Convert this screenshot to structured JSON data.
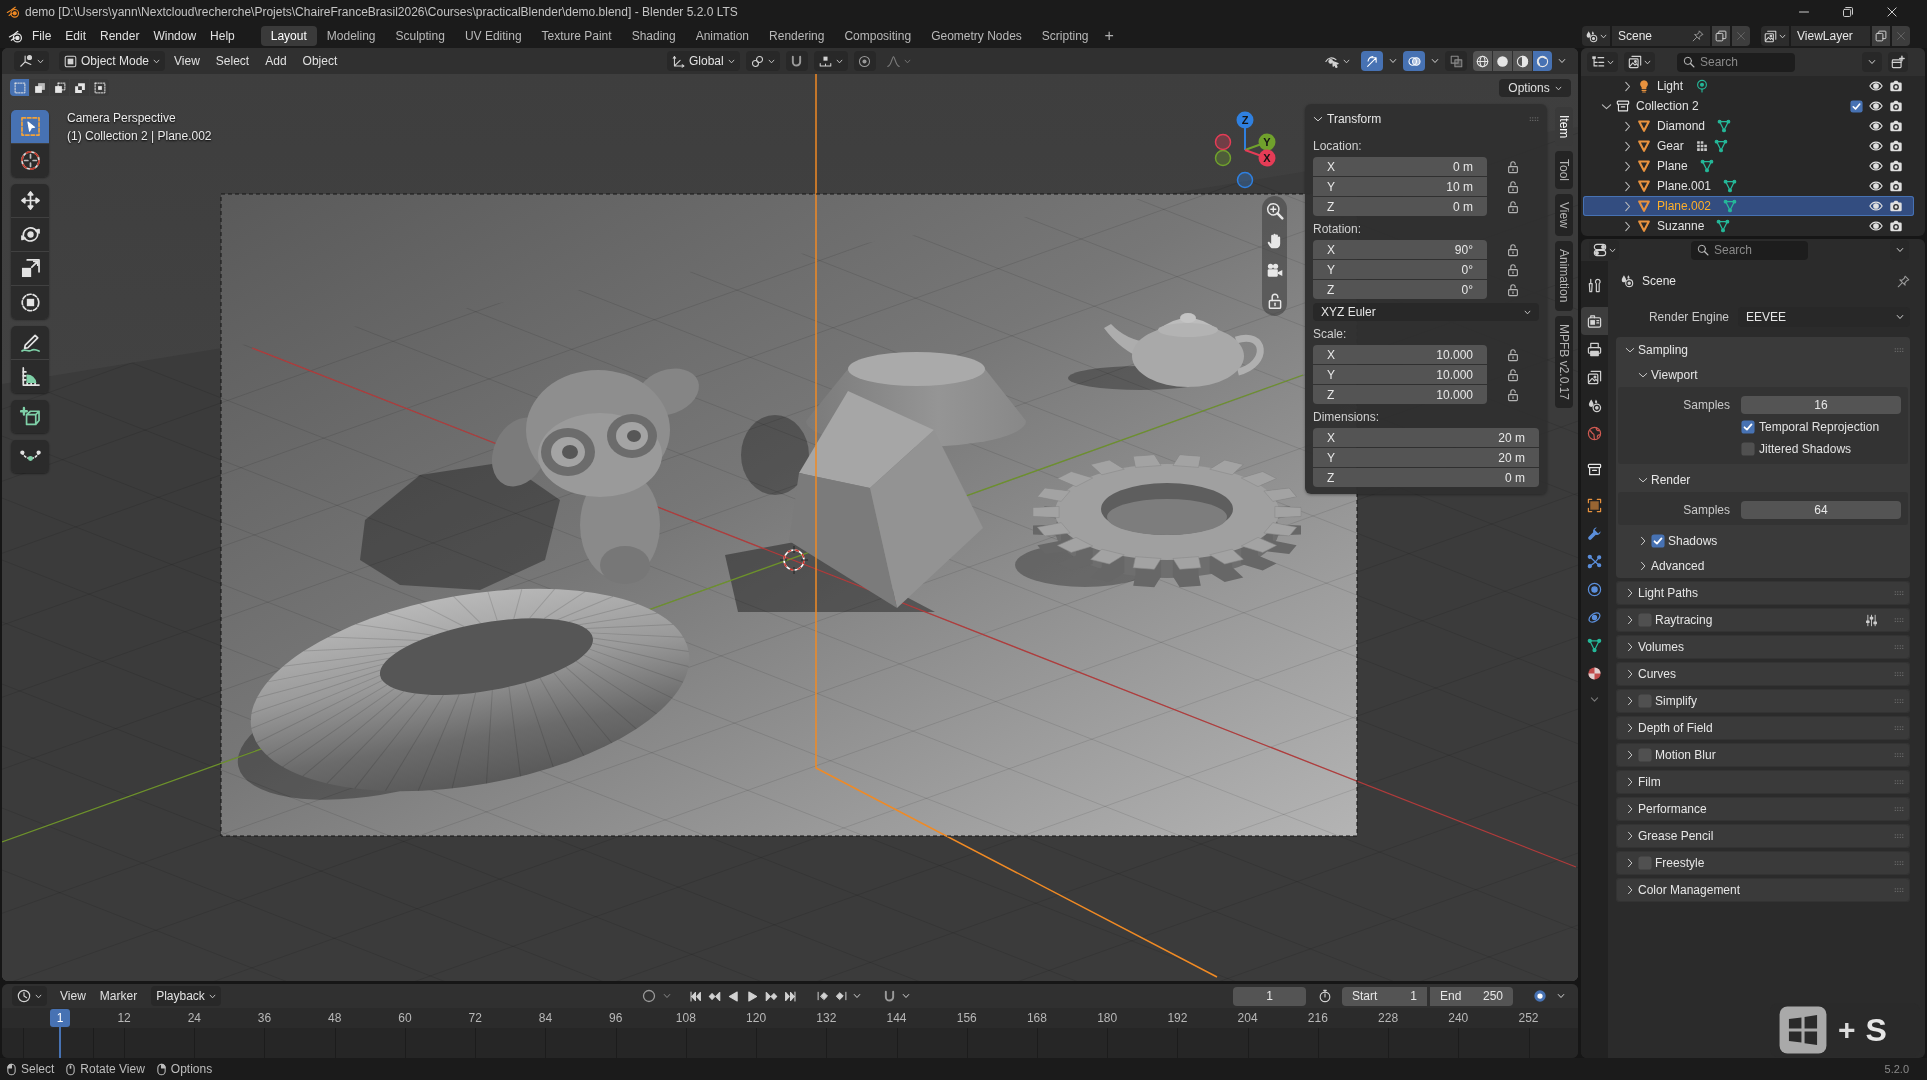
{
  "window": {
    "title": "demo [D:\\Users\\yann\\Nextcloud\\recherche\\Projets\\ChaireFranceBrasil2026\\Courses\\practicalBlender\\demo.blend] - Blender 5.2.0 LTS"
  },
  "menu": [
    "File",
    "Edit",
    "Render",
    "Window",
    "Help"
  ],
  "workspaces": [
    {
      "label": "Layout",
      "selected": true
    },
    {
      "label": "Modeling",
      "selected": false
    },
    {
      "label": "Sculpting",
      "selected": false
    },
    {
      "label": "UV Editing",
      "selected": false
    },
    {
      "label": "Texture Paint",
      "selected": false
    },
    {
      "label": "Shading",
      "selected": false
    },
    {
      "label": "Animation",
      "selected": false
    },
    {
      "label": "Rendering",
      "selected": false
    },
    {
      "label": "Compositing",
      "selected": false
    },
    {
      "label": "Geometry Nodes",
      "selected": false
    },
    {
      "label": "Scripting",
      "selected": false
    }
  ],
  "add_workspace": "+",
  "scene": {
    "value": "Scene"
  },
  "view_layer": {
    "value": "ViewLayer"
  },
  "viewport": {
    "mode": "Object Mode",
    "menus": [
      "View",
      "Select",
      "Add",
      "Object"
    ],
    "orientation": "Global",
    "snap_toggles": [
      {
        "kind": "snap",
        "on": false
      },
      {
        "kind": "proportional",
        "on": false
      }
    ],
    "overlay_toggles": [
      {
        "kind": "gizmos",
        "on": true
      },
      {
        "kind": "overlays",
        "on": true
      },
      {
        "kind": "xray",
        "on": false
      }
    ],
    "shading": [
      {
        "kind": "wireframe",
        "selected": false
      },
      {
        "kind": "solid",
        "selected": false
      },
      {
        "kind": "material",
        "selected": false
      },
      {
        "kind": "rendered",
        "selected": true
      }
    ],
    "options": "Options",
    "select_modes": [
      {
        "kind": "set",
        "selected": true
      },
      {
        "kind": "extend",
        "selected": false
      },
      {
        "kind": "subtract",
        "selected": false
      },
      {
        "kind": "difference",
        "selected": false
      },
      {
        "kind": "intersect",
        "selected": false
      }
    ],
    "tool_groups": [
      {
        "tools": [
          {
            "kind": "select-box",
            "selected": true
          },
          {
            "kind": "cursor",
            "selected": false
          }
        ]
      },
      {
        "tools": [
          {
            "kind": "move",
            "selected": false
          },
          {
            "kind": "rotate",
            "selected": false
          },
          {
            "kind": "scale",
            "selected": false
          },
          {
            "kind": "transform",
            "selected": false
          }
        ]
      },
      {
        "tools": [
          {
            "kind": "annotate",
            "selected": false
          },
          {
            "kind": "measure",
            "selected": false
          }
        ]
      },
      {
        "tools": [
          {
            "kind": "add-cube",
            "selected": false
          }
        ]
      },
      {
        "tools": [
          {
            "kind": "curve",
            "selected": false
          }
        ]
      }
    ],
    "info": [
      "Camera Perspective",
      "(1) Collection 2 | Plane.002"
    ],
    "gizmo_axes": [
      {
        "label": "Z",
        "color": "#2f80e0"
      },
      {
        "label": "Y",
        "color": "#70a12c"
      },
      {
        "label": "X",
        "color": "#e53c56"
      }
    ],
    "sidebar": {
      "tabs": [
        {
          "label": "Item",
          "selected": true
        },
        {
          "label": "Tool",
          "selected": false
        },
        {
          "label": "View",
          "selected": false
        },
        {
          "label": "Animation",
          "selected": false
        },
        {
          "label": "MPFB v2.0.17",
          "selected": false
        }
      ],
      "transform": {
        "title": "Transform",
        "expanded": true,
        "groups": [
          {
            "label": "Location:",
            "fields": [
              {
                "axis": "X",
                "value": "0 m",
                "locked": false
              },
              {
                "axis": "Y",
                "value": "10 m",
                "locked": false
              },
              {
                "axis": "Z",
                "value": "0 m",
                "locked": false
              }
            ]
          },
          {
            "label": "Rotation:",
            "fields": [
              {
                "axis": "X",
                "value": "90°",
                "locked": false
              },
              {
                "axis": "Y",
                "value": "0°",
                "locked": false
              },
              {
                "axis": "Z",
                "value": "0°",
                "locked": false
              }
            ],
            "mode": "XYZ Euler"
          },
          {
            "label": "Scale:",
            "fields": [
              {
                "axis": "X",
                "value": "10.000",
                "locked": false
              },
              {
                "axis": "Y",
                "value": "10.000",
                "locked": false
              },
              {
                "axis": "Z",
                "value": "10.000",
                "locked": false
              }
            ]
          },
          {
            "label": "Dimensions:",
            "fields": [
              {
                "axis": "X",
                "value": "20 m"
              },
              {
                "axis": "Y",
                "value": "20 m"
              },
              {
                "axis": "Z",
                "value": "0 m"
              }
            ]
          }
        ]
      }
    }
  },
  "outliner": {
    "search": {
      "placeholder": "Search"
    },
    "hidden_parent_children": [
      {
        "kind": "light",
        "name": "Light",
        "expanded": false,
        "selected": false,
        "visible": true,
        "renderable": true
      }
    ],
    "items": [
      {
        "kind": "collection",
        "name": "Collection 2",
        "expanded": true,
        "selected": false,
        "checked": true,
        "visible": true,
        "renderable": true,
        "children": [
          {
            "kind": "mesh",
            "name": "Diamond",
            "expanded": false,
            "selected": false,
            "visible": true,
            "renderable": true
          },
          {
            "kind": "mesh",
            "name": "Gear",
            "expanded": false,
            "selected": false,
            "modifier": true,
            "visible": true,
            "renderable": true
          },
          {
            "kind": "mesh",
            "name": "Plane",
            "expanded": false,
            "selected": false,
            "visible": true,
            "renderable": true
          },
          {
            "kind": "mesh",
            "name": "Plane.001",
            "expanded": false,
            "selected": false,
            "visible": true,
            "renderable": true
          },
          {
            "kind": "mesh",
            "name": "Plane.002",
            "expanded": false,
            "selected": true,
            "visible": true,
            "renderable": true
          },
          {
            "kind": "mesh",
            "name": "Suzanne",
            "expanded": false,
            "selected": false,
            "visible": true,
            "renderable": true
          }
        ]
      }
    ]
  },
  "properties": {
    "search": {
      "placeholder": "Search"
    },
    "tab_groups": [
      {
        "tabs": [
          {
            "kind": "tool",
            "selected": false
          }
        ]
      },
      {
        "tabs": [
          {
            "kind": "render",
            "selected": true
          },
          {
            "kind": "output",
            "selected": false
          },
          {
            "kind": "view-layer",
            "selected": false
          },
          {
            "kind": "scene",
            "selected": false
          },
          {
            "kind": "world",
            "selected": false
          }
        ]
      },
      {
        "tabs": [
          {
            "kind": "collection",
            "selected": false
          }
        ]
      },
      {
        "tabs": [
          {
            "kind": "object",
            "selected": false
          },
          {
            "kind": "modifiers",
            "selected": false
          },
          {
            "kind": "particles",
            "selected": false
          },
          {
            "kind": "physics",
            "selected": false
          },
          {
            "kind": "constraints",
            "selected": false
          },
          {
            "kind": "data",
            "selected": false
          },
          {
            "kind": "material",
            "selected": false
          }
        ]
      }
    ],
    "context": "Scene",
    "render_engine": {
      "label": "Render Engine",
      "value": "EEVEE"
    },
    "panels": [
      {
        "title": "Sampling",
        "expanded": true,
        "subpanels": [
          {
            "title": "Viewport",
            "expanded": true,
            "rows": [
              {
                "kind": "number",
                "label": "Samples",
                "value": "16"
              },
              {
                "kind": "checkbox",
                "label": "Temporal Reprojection",
                "checked": true
              },
              {
                "kind": "checkbox",
                "label": "Jittered Shadows",
                "checked": false
              }
            ]
          },
          {
            "title": "Render",
            "expanded": true,
            "rows": [
              {
                "kind": "number",
                "label": "Samples",
                "value": "64"
              }
            ]
          },
          {
            "title": "Shadows",
            "expanded": false,
            "checked": true
          },
          {
            "title": "Advanced",
            "expanded": false
          }
        ]
      },
      {
        "title": "Light Paths",
        "expanded": false
      },
      {
        "title": "Raytracing",
        "expanded": false,
        "checked": false,
        "presets": true
      },
      {
        "title": "Volumes",
        "expanded": false
      },
      {
        "title": "Curves",
        "expanded": false
      },
      {
        "title": "Simplify",
        "expanded": false,
        "checked": false
      },
      {
        "title": "Depth of Field",
        "expanded": false
      },
      {
        "title": "Motion Blur",
        "expanded": false,
        "checked": false
      },
      {
        "title": "Film",
        "expanded": false
      },
      {
        "title": "Performance",
        "expanded": false
      },
      {
        "title": "Grease Pencil",
        "expanded": false
      },
      {
        "title": "Freestyle",
        "expanded": false,
        "checked": false
      },
      {
        "title": "Color Management",
        "expanded": false
      }
    ]
  },
  "timeline": {
    "menus": [
      "View",
      "Marker"
    ],
    "playback": "Playback",
    "auto_key": false,
    "frame": "1",
    "start": {
      "label": "Start",
      "value": "1"
    },
    "end": {
      "label": "End",
      "value": "250"
    },
    "playhead": "1",
    "ticks": [
      "12",
      "24",
      "36",
      "48",
      "60",
      "72",
      "84",
      "96",
      "108",
      "120",
      "132",
      "144",
      "156",
      "168",
      "180",
      "192",
      "204",
      "216",
      "228",
      "240",
      "252"
    ]
  },
  "status_bar": {
    "hints": [
      {
        "kind": "left",
        "label": "Select"
      },
      {
        "kind": "middle",
        "label": "Rotate View"
      },
      {
        "kind": "right",
        "label": "Options"
      }
    ],
    "version": "5.2.0"
  },
  "key_overlay": {
    "separator": "+",
    "key": "S"
  }
}
